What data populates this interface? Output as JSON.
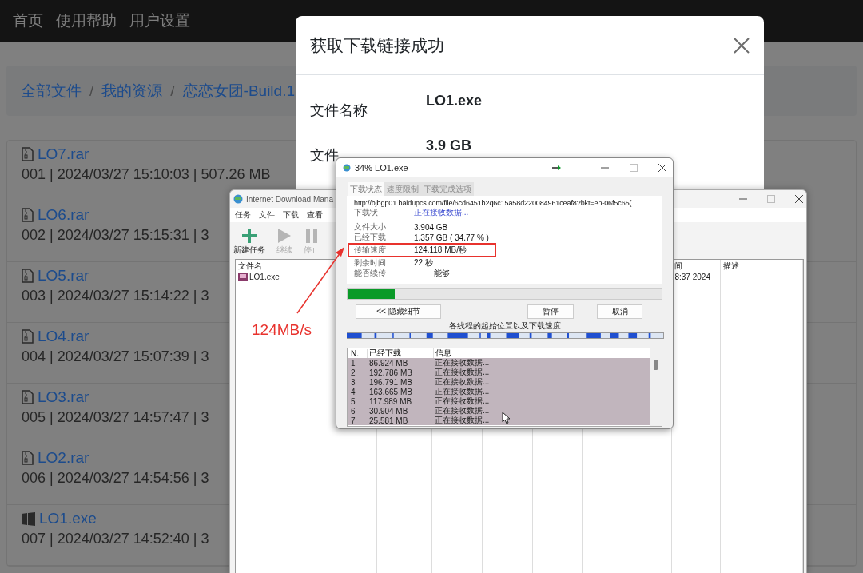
{
  "navbar": {
    "items": [
      "首页",
      "使用帮助",
      "用户设置"
    ]
  },
  "breadcrumb": [
    {
      "kind": "link",
      "text": "全部文件"
    },
    {
      "kind": "separator",
      "text": "/"
    },
    {
      "kind": "link",
      "text": "我的资源"
    },
    {
      "kind": "separator",
      "text": "/"
    },
    {
      "kind": "link",
      "text": "恋恋女团-Build.1"
    }
  ],
  "files": [
    {
      "name": "LO7.rar",
      "kind": "archive",
      "meta": "001 | 2024/03/27 15:10:03 | 507.26 MB"
    },
    {
      "name": "LO6.rar",
      "kind": "archive",
      "meta": "002 | 2024/03/27 15:15:31 | 3"
    },
    {
      "name": "LO5.rar",
      "kind": "archive",
      "meta": "003 | 2024/03/27 15:14:22 | 3"
    },
    {
      "name": "LO4.rar",
      "kind": "archive",
      "meta": "004 | 2024/03/27 15:07:39 | 3"
    },
    {
      "name": "LO3.rar",
      "kind": "archive",
      "meta": "005 | 2024/03/27 14:57:47 | 3"
    },
    {
      "name": "LO2.rar",
      "kind": "archive",
      "meta": "006 | 2024/03/27 14:54:56 | 3"
    },
    {
      "name": "LO1.exe",
      "kind": "windows",
      "meta": "007 | 2024/03/27 14:52:40 | 3"
    }
  ],
  "modal": {
    "title": "获取下载链接成功",
    "fields": [
      {
        "label": "文件名称",
        "value": "LO1.exe"
      },
      {
        "label": "文件",
        "value": "3.9 GB"
      }
    ]
  },
  "idm_main": {
    "title": "Internet Download Mana",
    "menu": [
      "任务",
      "文件",
      "下载",
      "查看"
    ],
    "toolbar": [
      {
        "label": "新建任务",
        "kind": "add",
        "disabled": false
      },
      {
        "label": "继续",
        "kind": "resume",
        "disabled": true
      },
      {
        "label": "停止",
        "kind": "stop",
        "disabled": true
      }
    ],
    "columns": [
      "文件名",
      "间",
      "描述"
    ],
    "rows": [
      {
        "name": "LO1.exe",
        "time": "8:37 2024"
      }
    ]
  },
  "idm_dialog": {
    "title": "34% LO1.exe",
    "tabs": [
      {
        "label": "下载状态",
        "selected": true
      },
      {
        "label": "速度限制",
        "selected": false
      },
      {
        "label": "下载完成选项",
        "selected": false
      }
    ],
    "url": "http://bjbgp01.baidupcs.com/file/6cd6451b2q6c15a58d220084961ceaf8?bkt=en-06f5c65(",
    "status_label": "下载状",
    "status": "正在接收数据...",
    "details": [
      {
        "label": "文件大小",
        "value": "3.904  GB",
        "highlighted": false
      },
      {
        "label": "已经下载",
        "value": "1.357  GB  ( 34.77 % )",
        "highlighted": false
      },
      {
        "label": "传输速度",
        "value": "124.118  MB/秒",
        "highlighted": true
      },
      {
        "label": "剩余时间",
        "value": "22 秒",
        "highlighted": false
      },
      {
        "label": "能否续传",
        "value": "能够",
        "highlighted": false
      }
    ],
    "progress": {
      "level": 0.15
    },
    "buttons": [
      "<< 隐藏细节",
      "暂停",
      "取消"
    ],
    "threads_caption": "各线程的起始位置以及下载速度",
    "thread_columns": [
      "N.",
      "已经下载",
      "信息"
    ],
    "threads": [
      {
        "n": "1",
        "downloaded": "86.924  MB",
        "info": "正在接收数据...",
        "selected": true
      },
      {
        "n": "2",
        "downloaded": "192.786  MB",
        "info": "正在接收数据...",
        "selected": true
      },
      {
        "n": "3",
        "downloaded": "196.791  MB",
        "info": "正在接收数据...",
        "selected": true
      },
      {
        "n": "4",
        "downloaded": "163.665  MB",
        "info": "正在接收数据...",
        "selected": true
      },
      {
        "n": "5",
        "downloaded": "117.989  MB",
        "info": "正在接收数据...",
        "selected": true
      },
      {
        "n": "6",
        "downloaded": "30.904  MB",
        "info": "正在接收数据...",
        "selected": true
      },
      {
        "n": "7",
        "downloaded": "25.581  MB",
        "info": "正在接收数据...",
        "selected": true
      }
    ]
  },
  "annotation": {
    "text": "124MB/s"
  }
}
